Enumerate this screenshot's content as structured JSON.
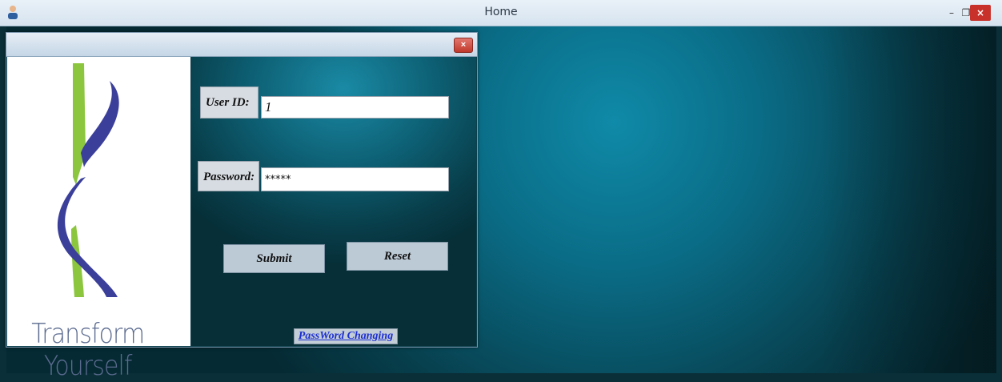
{
  "window": {
    "title": "Home",
    "minimize_glyph": "–",
    "maximize_glyph": "❐",
    "close_glyph": "×"
  },
  "login": {
    "close_glyph": "×",
    "logo_text": "Transform Yourself",
    "user_id_label": "User ID:",
    "user_id_value": "1",
    "password_label": "Password:",
    "password_value": "*****",
    "submit_label": "Submit",
    "reset_label": "Reset",
    "password_change_link": "PassWord Changing"
  },
  "colors": {
    "logo_green": "#8cc63f",
    "logo_blue": "#3b3f9a",
    "link": "#1d2fd1"
  }
}
